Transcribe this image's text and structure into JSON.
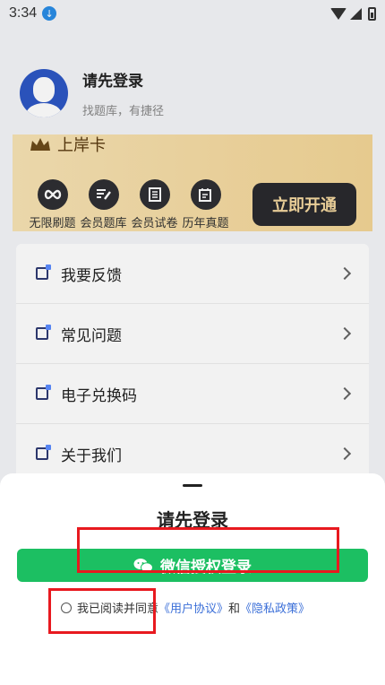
{
  "status_bar": {
    "time": "3:34"
  },
  "profile": {
    "title": "请先登录",
    "subtitle": "找题库，有捷径"
  },
  "vip": {
    "title": "上岸卡",
    "benefits": [
      "无限刷题",
      "会员题库",
      "会员试卷",
      "历年真题"
    ],
    "open_label": "立即开通"
  },
  "menu": {
    "items": [
      {
        "label": "我要反馈"
      },
      {
        "label": "常见问题"
      },
      {
        "label": "电子兑换码"
      },
      {
        "label": "关于我们"
      }
    ]
  },
  "sheet": {
    "title": "请先登录",
    "wechat_label": "微信授权登录",
    "agree_prefix": "我已阅读并同意",
    "user_agreement": "《用户协议》",
    "and": "和",
    "privacy_policy": "《隐私政策》"
  },
  "colors": {
    "accent": "#1cbf62",
    "link": "#3b6fd8",
    "annotation": "#e8191f"
  },
  "icons": [
    "download-icon",
    "wifi-icon",
    "signal-icon",
    "battery-icon",
    "crown-icon",
    "infinity-icon",
    "edit-icon",
    "book-icon",
    "calendar-icon",
    "chevron-right-icon",
    "wechat-icon"
  ]
}
